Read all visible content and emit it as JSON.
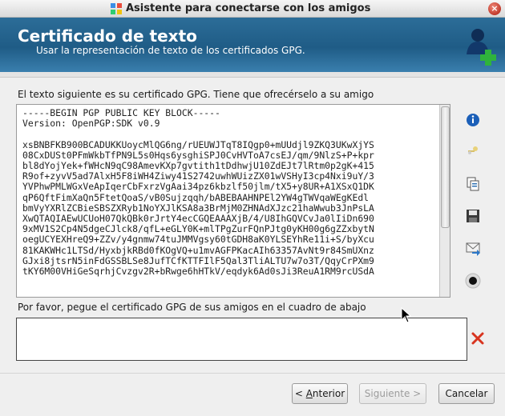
{
  "window": {
    "title": "Asistente para conectarse con los amigos",
    "close_glyph": "×"
  },
  "header": {
    "title": "Certificado de texto",
    "subtitle": "Usar la representación de texto de los certificados GPG.",
    "icon": "user-add-icon"
  },
  "certificate": {
    "label": "El texto siguiente es su certificado GPG. Tiene que ofrecérselo a su amigo",
    "lines": [
      "-----BEGIN PGP PUBLIC KEY BLOCK-----",
      "Version: OpenPGP:SDK v0.9",
      "",
      "xsBNBFKB900BCADUKKUoycMlQG6ng/rUEUWJTqT8IQgp0+mUUdjl9ZKQ3UKwXjYS",
      "08CxDUSt0PFmWkbTfPN9L5s0Hqs6ysghiSPJ0CvHVToA7csEJ/qm/9NlzS+P+kpr",
      "bl8dYojYek+fWHcN9qC98AmevKXp7gvtith1tDdhwjU10ZdEJt7lRtm0p2gK+415",
      "R9of+zyvV5ad7AlxH5F8iWH4Ziwy41S2742uwhWUizZX01wVSHyI3cp4Nxi9uY/3",
      "YVPhwPMLWGxVeApIqerCbFxrzVgAai34pz6kbzlf50jlm/tX5+y8UR+A1XSxQ1DK",
      "qP6QftFimXaQn5FtetQoaS/vB0Sujzqqh/bABEBAAHNPEl2YW4gTWVqaWEgKEdl",
      "bmVyYXRlZCBieSBSZXRyb1NoYXJlKSA8a3BrMjM0ZHNAdXJzc21haWwub3JnPsLA",
      "XwQTAQIAEwUCUoH07QkQBk0rJrtY4ecCGQEAAAXjB/4/U8IhGQVCvJa0lIiDn690",
      "9xMV1S2Cp4N5dgeCJlck8/qfL+eGLY0K+mlTPgZurFQnPJtg0yKH00g6gZZxbytN",
      "oegUCYEXHreQ9+ZZv/y4gnmw74tuJMMVgsy60tGDH8aK0YLSEYhRe11i+S/byXcu",
      "81KAKWHc1LTSd/HyxbjkRBd0fKOgVQ+u1mvAGFPKacAIh63357AvNt9r84SmUXnz",
      "GJxi8jtsrN5inFdGSSBLSe8JufTCfKTTFIlF5Qal3TliALTU7w7o3T/QqyCrPXm9",
      "tKY6M00VHiGeSqrhjCvzgv2R+bRwge6hHTkV/eqdyk6Ad0sJi3ReuA1RM9rcUSdA"
    ],
    "scrollbar_value": 0.62
  },
  "sidebar": {
    "icons": [
      "info-icon",
      "key-icon",
      "copy-icon",
      "save-icon",
      "email-icon",
      "record-icon"
    ]
  },
  "paste": {
    "label": "Por favor, pegue el certificado GPG de sus amigos en el cuadro de abajo",
    "value": "",
    "clear_icon": "clear-icon"
  },
  "buttons": {
    "back_lt": "< ",
    "back_mnemonic": "A",
    "back_rest": "nterior",
    "next_label": "Siguiente >",
    "cancel_label": "Cancelar"
  },
  "colors": {
    "header_bg": "#1f5c86",
    "header_text": "#ffffff",
    "window_bg": "#efefef",
    "close_red": "#c0392b"
  }
}
